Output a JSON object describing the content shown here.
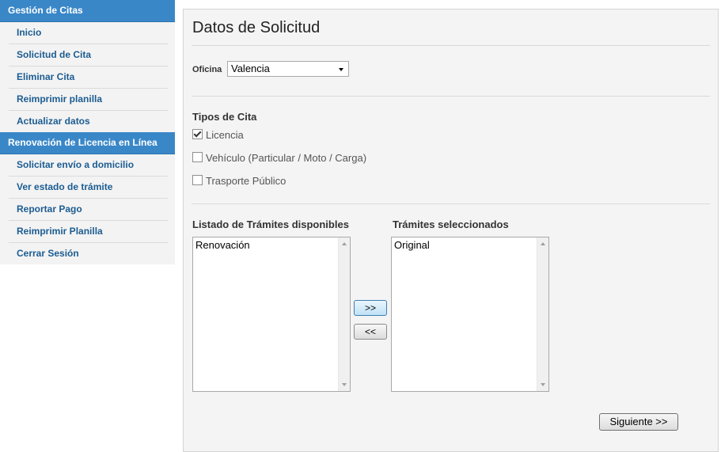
{
  "sidebar": {
    "sections": [
      {
        "header": "Gestión de Citas",
        "items": [
          "Inicio",
          "Solicitud de Cita",
          "Eliminar Cita",
          "Reimprimir planilla",
          "Actualizar datos"
        ]
      },
      {
        "header": "Renovación de Licencia en Línea",
        "items": [
          "Solicitar envío a domicilio",
          "Ver estado de trámite",
          "Reportar Pago",
          "Reimprimir Planilla",
          "Cerrar Sesión"
        ]
      }
    ]
  },
  "main": {
    "title": "Datos de Solicitud",
    "oficina": {
      "label": "Oficina",
      "selected": "Valencia"
    },
    "tipos": {
      "label": "Tipos de Cita",
      "options": [
        {
          "label": "Licencia",
          "checked": true
        },
        {
          "label": "Vehículo (Particular / Moto / Carga)",
          "checked": false
        },
        {
          "label": "Trasporte Público",
          "checked": false
        }
      ]
    },
    "available": {
      "label": "Listado de Trámites disponibles",
      "items": [
        "Renovación"
      ]
    },
    "selected": {
      "label": "Trámites seleccionados",
      "items": [
        "Original"
      ]
    },
    "add_button": ">>",
    "remove_button": "<<",
    "next_button": "Siguiente >>"
  },
  "colors": {
    "accent": "#3a87c8",
    "link": "#1b5c91",
    "panel": "#f4f4f4"
  }
}
